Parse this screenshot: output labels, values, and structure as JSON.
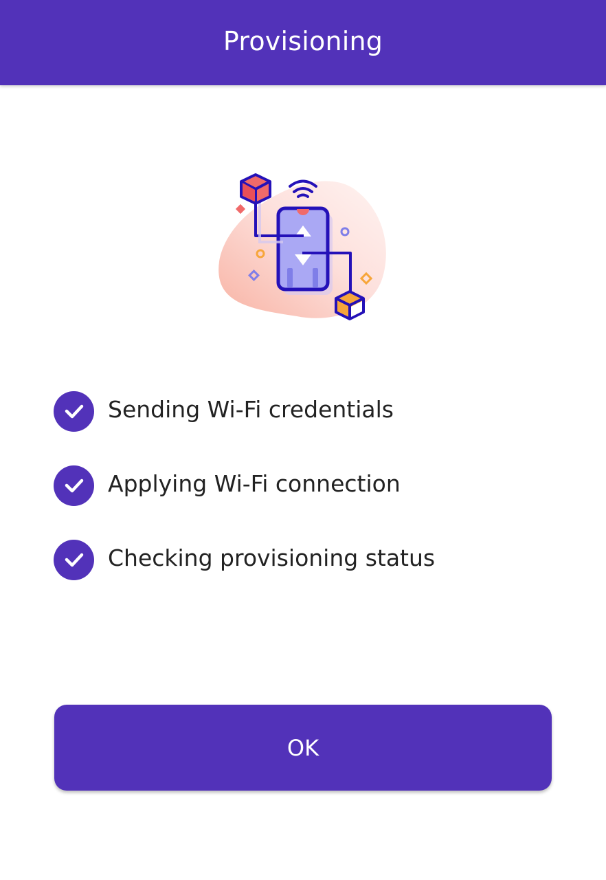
{
  "header": {
    "title": "Provisioning"
  },
  "illustration": {
    "icon": "phone-provisioning-illustration"
  },
  "steps": [
    {
      "label": "Sending Wi-Fi credentials",
      "status": "done",
      "icon": "check-icon"
    },
    {
      "label": "Applying Wi-Fi connection",
      "status": "done",
      "icon": "check-icon"
    },
    {
      "label": "Checking provisioning status",
      "status": "done",
      "icon": "check-icon"
    }
  ],
  "actions": {
    "ok_label": "OK"
  },
  "colors": {
    "primary": "#5232b9",
    "text": "#222222",
    "background": "#ffffff"
  }
}
